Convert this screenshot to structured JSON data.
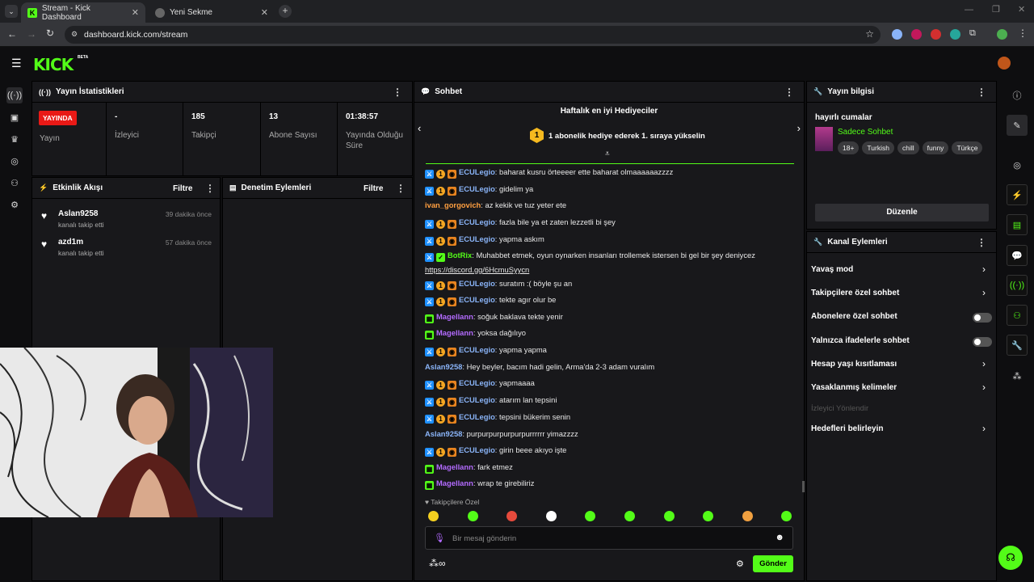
{
  "browser": {
    "tabs": [
      {
        "title": "Stream - Kick Dashboard",
        "active": true
      },
      {
        "title": "Yeni Sekme",
        "active": false
      }
    ],
    "url": "dashboard.kick.com/stream"
  },
  "header": {
    "logo": "KICK",
    "beta": "BETA"
  },
  "left_nav": [
    "broadcast-icon",
    "dashboard-icon",
    "trophy-icon",
    "camera-icon",
    "users-icon",
    "settings-icon"
  ],
  "stream_stats": {
    "title": "Yayın İstatistikleri",
    "live_badge": "YAYINDA",
    "items": [
      {
        "value": "",
        "label": "Yayın"
      },
      {
        "value": "-",
        "label": "İzleyici"
      },
      {
        "value": "185",
        "label": "Takipçi"
      },
      {
        "value": "13",
        "label": "Abone Sayısı"
      },
      {
        "value": "01:38:57",
        "label": "Yayında Olduğu Süre"
      }
    ]
  },
  "activity_feed": {
    "title": "Etkinlik Akışı",
    "filter": "Filtre",
    "events": [
      {
        "user": "Aslan9258",
        "action": "kanalı takip etti",
        "time": "39 dakika önce"
      },
      {
        "user": "azd1m",
        "action": "kanalı takip etti",
        "time": "57 dakika önce"
      }
    ]
  },
  "mod_actions": {
    "title": "Denetim Eylemleri",
    "filter": "Filtre"
  },
  "chat": {
    "title": "Sohbet",
    "gifters_title": "Haftalık en iyi Hediyeciler",
    "gifters_rank": "1",
    "gifters_text": "1 abonelik hediye ederek 1. sıraya yükselin",
    "messages": [
      {
        "user": "ECULegio",
        "color": "#8ab4f8",
        "badges": 3,
        "text": "baharat kusru örteeeer ette baharat olmaaaaaazzzz"
      },
      {
        "user": "ECULegio",
        "color": "#8ab4f8",
        "badges": 3,
        "text": "gidelim ya"
      },
      {
        "user": "ivan_gorgovich",
        "color": "#ff9f40",
        "badges": 0,
        "text": "az kekik ve tuz yeter ete"
      },
      {
        "user": "ECULegio",
        "color": "#8ab4f8",
        "badges": 3,
        "text": "fazla bile ya et zaten lezzetli bi şey"
      },
      {
        "user": "ECULegio",
        "color": "#8ab4f8",
        "badges": 3,
        "text": "yapma askım"
      },
      {
        "user": "BotRix",
        "color": "#53fc18",
        "badges": 2,
        "text": "Muhabbet etmek, oyun oynarken insanları trollemek istersen bi gel bir şey deniycez",
        "link": "https://discord.gg/6HcmuSyycn"
      },
      {
        "user": "ECULegio",
        "color": "#8ab4f8",
        "badges": 3,
        "text": "suratım :( böyle şu an"
      },
      {
        "user": "ECULegio",
        "color": "#8ab4f8",
        "badges": 3,
        "text": "tekte agır olur be"
      },
      {
        "user": "Magellann",
        "color": "#b36bff",
        "badges": 1,
        "text": "soğuk baklava tekte yenir"
      },
      {
        "user": "Magellann",
        "color": "#b36bff",
        "badges": 1,
        "text": "yoksa dağılıyo"
      },
      {
        "user": "ECULegio",
        "color": "#8ab4f8",
        "badges": 3,
        "text": "yapma yapma"
      },
      {
        "user": "Aslan9258",
        "color": "#8ab4f8",
        "badges": 0,
        "text": "Hey beyler, bacım hadi gelin, Arma'da 2-3 adam vuralım"
      },
      {
        "user": "ECULegio",
        "color": "#8ab4f8",
        "badges": 3,
        "text": "yapmaaaa"
      },
      {
        "user": "ECULegio",
        "color": "#8ab4f8",
        "badges": 3,
        "text": "atarım lan tepsini"
      },
      {
        "user": "ECULegio",
        "color": "#8ab4f8",
        "badges": 3,
        "text": "tepsini bükerim senin"
      },
      {
        "user": "Aslan9258",
        "color": "#8ab4f8",
        "badges": 0,
        "text": "purpurpurpurpurpurrrrrr yimazzzz"
      },
      {
        "user": "ECULegio",
        "color": "#8ab4f8",
        "badges": 3,
        "text": "girin beee akıyo işte"
      },
      {
        "user": "Magellann",
        "color": "#b36bff",
        "badges": 1,
        "text": "fark etmez"
      },
      {
        "user": "Magellann",
        "color": "#b36bff",
        "badges": 1,
        "text": "wrap te girebiliriz"
      }
    ],
    "followers_only": "Takipçilere Özel",
    "input_placeholder": "Bir mesaj gönderin",
    "send": "Gönder"
  },
  "stream_info": {
    "title": "Yayın bilgisi",
    "stream_title": "hayırlı cumalar",
    "category": "Sadece Sohbet",
    "tags": [
      "18+",
      "Turkish",
      "chill",
      "funny",
      "Türkçe"
    ],
    "edit": "Düzenle"
  },
  "channel_actions": {
    "title": "Kanal Eylemleri",
    "items": [
      {
        "label": "Yavaş mod",
        "control": "chevron"
      },
      {
        "label": "Takipçilere özel sohbet",
        "control": "chevron"
      },
      {
        "label": "Abonelere özel sohbet",
        "control": "toggle"
      },
      {
        "label": "Yalnızca ifadelerle sohbet",
        "control": "toggle"
      },
      {
        "label": "Hesap yaşı kısıtlaması",
        "control": "chevron"
      },
      {
        "label": "Yasaklanmış kelimeler",
        "control": "chevron"
      },
      {
        "label": "İzleyici Yönlendir",
        "control": "disabled"
      },
      {
        "label": "Hedefleri belirleyin",
        "control": "chevron"
      }
    ]
  },
  "colors": {
    "accent": "#53fc18",
    "live": "#e91916",
    "panel": "#18181b",
    "bg": "#0e0e10"
  }
}
